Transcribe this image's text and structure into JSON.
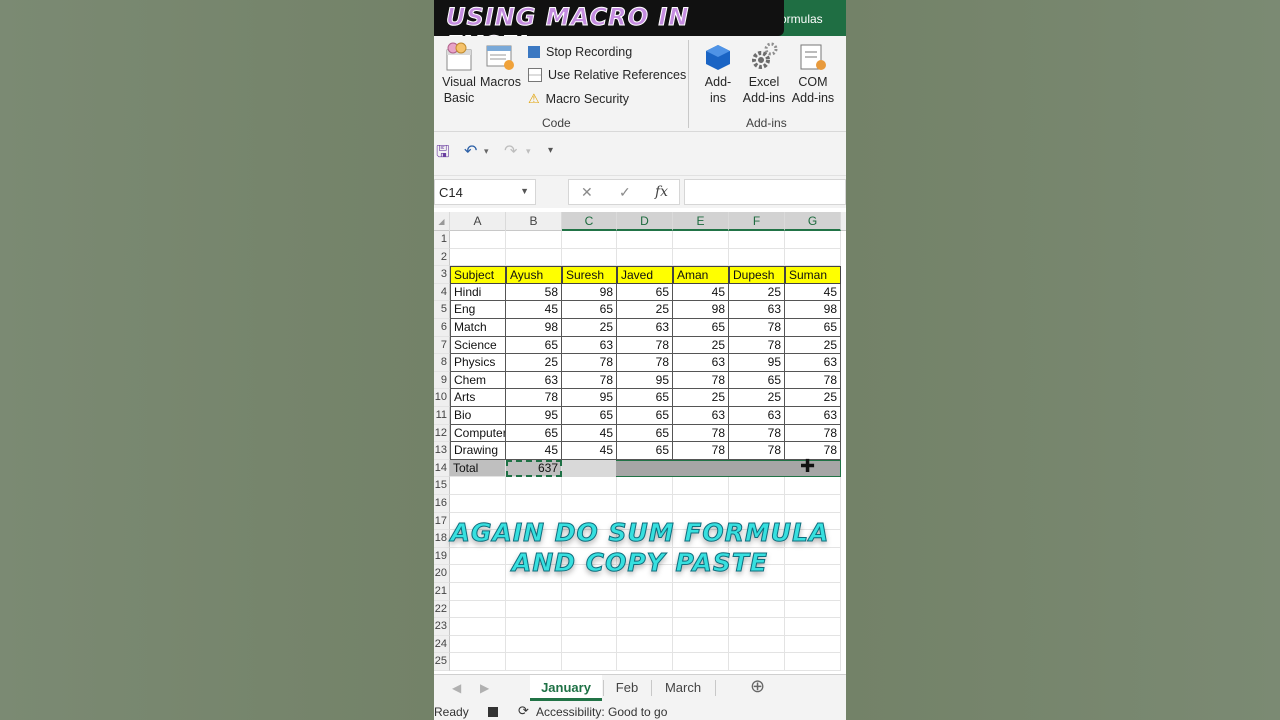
{
  "banner_title": "USING MACRO IN EXCEL",
  "ribbon": {
    "active_tab_partial": "ormulas",
    "code_group": {
      "visual_basic": "Visual Basic",
      "macros": "Macros",
      "stop_recording": "Stop Recording",
      "use_relative_references": "Use Relative References",
      "macro_security": "Macro Security",
      "label": "Code"
    },
    "addins_group": {
      "addins": "Add-ins",
      "excel_addins": "Excel Add-ins",
      "com_addins": "COM Add-ins",
      "label": "Add-ins"
    }
  },
  "formula_bar": {
    "name_box": "C14",
    "fx_label": "fx",
    "formula": ""
  },
  "columns": [
    "A",
    "B",
    "C",
    "D",
    "E",
    "F",
    "G"
  ],
  "rows": [
    "1",
    "2",
    "3",
    "4",
    "5",
    "6",
    "7",
    "8",
    "9",
    "10",
    "11",
    "12",
    "13",
    "14",
    "15",
    "16",
    "17",
    "18",
    "19",
    "20",
    "21",
    "22",
    "23",
    "24",
    "25"
  ],
  "table": {
    "header": [
      "Subject",
      "Ayush",
      "Suresh",
      "Javed",
      "Aman",
      "Dupesh",
      "Suman"
    ],
    "data": [
      [
        "Hindi",
        "58",
        "98",
        "65",
        "45",
        "25",
        "45"
      ],
      [
        "Eng",
        "45",
        "65",
        "25",
        "98",
        "63",
        "98"
      ],
      [
        "Match",
        "98",
        "25",
        "63",
        "65",
        "78",
        "65"
      ],
      [
        "Science",
        "65",
        "63",
        "78",
        "25",
        "78",
        "25"
      ],
      [
        "Physics",
        "25",
        "78",
        "78",
        "63",
        "95",
        "63"
      ],
      [
        "Chem",
        "63",
        "78",
        "95",
        "78",
        "65",
        "78"
      ],
      [
        "Arts",
        "78",
        "95",
        "65",
        "25",
        "25",
        "25"
      ],
      [
        "Bio",
        "95",
        "65",
        "65",
        "63",
        "63",
        "63"
      ],
      [
        "Computer",
        "65",
        "45",
        "65",
        "78",
        "78",
        "78"
      ],
      [
        "Drawing",
        "45",
        "45",
        "65",
        "78",
        "78",
        "78"
      ]
    ],
    "total_label": "Total",
    "total_value": "637"
  },
  "overlay": {
    "line1": "AGAIN DO SUM FORMULA",
    "line2": "AND COPY PASTE"
  },
  "sheets": {
    "tabs": [
      "January",
      "Feb",
      "March"
    ],
    "active": "January"
  },
  "status": {
    "ready": "Ready",
    "accessibility": "Accessibility: Good to go"
  },
  "colors": {
    "excel_green": "#217346",
    "header_fill": "#ffff00",
    "overlay_text": "#37e0df",
    "banner_text": "#c58de0"
  }
}
